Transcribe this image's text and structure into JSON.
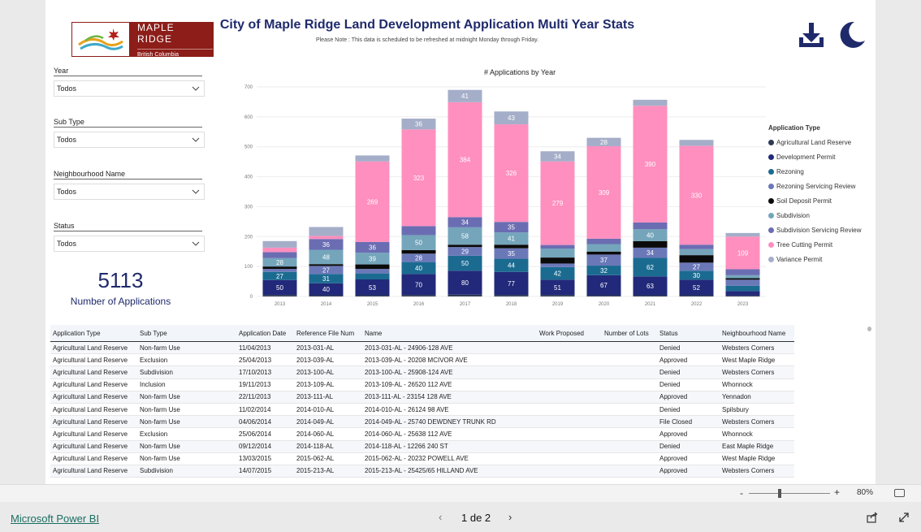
{
  "header": {
    "logo_main": "MAPLE RIDGE",
    "logo_sub": "British Columbia",
    "title": "City of Maple Ridge Land Development Application Multi Year Stats",
    "note": "Please Note : This data is scheduled to be refreshed at midnight Monday through Friday.",
    "download_icon": "download-icon",
    "theme_icon": "moon-icon"
  },
  "filters": [
    {
      "label": "Year",
      "value": "Todos"
    },
    {
      "label": "Sub Type",
      "value": "Todos"
    },
    {
      "label": "Neighbourhood Name",
      "value": "Todos"
    },
    {
      "label": "Status",
      "value": "Todos"
    }
  ],
  "kpi": {
    "value": "5113",
    "label": "Number of Applications"
  },
  "chart_data": {
    "type": "bar",
    "stacked": true,
    "title": "# Applications by Year",
    "categories": [
      "2013",
      "2014",
      "2015",
      "2016",
      "2017",
      "2018",
      "2019",
      "2020",
      "2021",
      "2022",
      "2023"
    ],
    "ylim": [
      0,
      700
    ],
    "yticks": [
      0,
      100,
      200,
      300,
      400,
      500,
      600,
      700
    ],
    "legend_title": "Application Type",
    "legend_position": "right",
    "series": [
      {
        "name": "Agricultural Land Reserve",
        "color": "#2f3b55",
        "values": [
          5,
          4,
          4,
          5,
          6,
          5,
          5,
          4,
          4,
          4,
          3
        ]
      },
      {
        "name": "Development Permit",
        "color": "#22297a",
        "values": [
          50,
          40,
          53,
          70,
          80,
          77,
          51,
          67,
          63,
          52,
          15
        ]
      },
      {
        "name": "Rezoning",
        "color": "#1b6b91",
        "values": [
          27,
          31,
          20,
          40,
          50,
          44,
          42,
          32,
          62,
          30,
          18
        ]
      },
      {
        "name": "Rezoning Servicing Review",
        "color": "#6b78b8",
        "values": [
          10,
          27,
          15,
          28,
          29,
          35,
          12,
          37,
          34,
          27,
          20
        ]
      },
      {
        "name": "Soil Deposit Permit",
        "color": "#0b0b0b",
        "values": [
          8,
          6,
          15,
          12,
          8,
          12,
          20,
          10,
          22,
          25,
          5
        ]
      },
      {
        "name": "Subdivision",
        "color": "#74a5bb",
        "values": [
          28,
          48,
          39,
          50,
          58,
          41,
          30,
          25,
          40,
          20,
          10
        ]
      },
      {
        "name": "Subdivision Servicing Review",
        "color": "#6b6db3",
        "values": [
          20,
          36,
          36,
          30,
          34,
          35,
          12,
          18,
          22,
          15,
          20
        ]
      },
      {
        "name": "Tree Cutting Permit",
        "color": "#ff8fbf",
        "values": [
          15,
          10,
          269,
          323,
          384,
          326,
          279,
          309,
          390,
          330,
          109
        ]
      },
      {
        "name": "Variance Permit",
        "color": "#a5aec8",
        "values": [
          22,
          30,
          20,
          36,
          41,
          43,
          34,
          28,
          20,
          20,
          12
        ]
      }
    ],
    "data_labels": {
      "Development Permit": [
        50,
        40,
        53,
        70,
        80,
        77,
        51,
        67,
        63,
        52,
        null
      ],
      "Rezoning": [
        27,
        31,
        null,
        40,
        50,
        44,
        42,
        32,
        62,
        30,
        null
      ],
      "Rezoning Servicing Review": [
        null,
        27,
        null,
        28,
        29,
        35,
        null,
        37,
        34,
        27,
        null
      ],
      "Subdivision": [
        28,
        48,
        39,
        50,
        58,
        41,
        null,
        null,
        40,
        null,
        null
      ],
      "Subdivision Servicing Review": [
        null,
        36,
        36,
        null,
        34,
        35,
        null,
        null,
        null,
        null,
        null
      ],
      "Tree Cutting Permit": [
        null,
        null,
        269,
        323,
        384,
        326,
        279,
        309,
        390,
        330,
        109
      ],
      "Variance Permit": [
        null,
        null,
        null,
        36,
        41,
        43,
        34,
        28,
        null,
        null,
        null
      ]
    }
  },
  "table": {
    "columns": [
      "Application Type",
      "Sub Type",
      "Application Date",
      "Reference File Num",
      "Name",
      "Work Proposed",
      "Number of Lots",
      "Status",
      "Neighbourhood Name"
    ],
    "rows": [
      [
        "Agricultural Land Reserve",
        "Non-farm Use",
        "11/04/2013",
        "2013-031-AL",
        "2013-031-AL - 24906-128 AVE",
        "",
        "",
        "Denied",
        "Websters Corners"
      ],
      [
        "Agricultural Land Reserve",
        "Exclusion",
        "25/04/2013",
        "2013-039-AL",
        "2013-039-AL - 20208  MCIVOR AVE",
        "",
        "",
        "Approved",
        "West Maple Ridge"
      ],
      [
        "Agricultural Land Reserve",
        "Subdivision",
        "17/10/2013",
        "2013-100-AL",
        "2013-100-AL - 25908-124 AVE",
        "",
        "",
        "Denied",
        "Websters Corners"
      ],
      [
        "Agricultural Land Reserve",
        "Inclusion",
        "19/11/2013",
        "2013-109-AL",
        "2013-109-AL - 26520  112 AVE",
        "",
        "",
        "Denied",
        "Whonnock"
      ],
      [
        "Agricultural Land Reserve",
        "Non-farm Use",
        "22/11/2013",
        "2013-111-AL",
        "2013-111-AL - 23154  128 AVE",
        "",
        "",
        "Approved",
        "Yennadon"
      ],
      [
        "Agricultural Land Reserve",
        "Non-farm Use",
        "11/02/2014",
        "2014-010-AL",
        "2014-010-AL - 26124  98 AVE",
        "",
        "",
        "Denied",
        "Spilsbury"
      ],
      [
        "Agricultural Land Reserve",
        "Non-farm Use",
        "04/06/2014",
        "2014-049-AL",
        "2014-049-AL - 25740  DEWDNEY TRUNK RD",
        "",
        "",
        "File Closed",
        "Websters Corners"
      ],
      [
        "Agricultural Land Reserve",
        "Exclusion",
        "25/06/2014",
        "2014-060-AL",
        "2014-060-AL - 25638  112 AVE",
        "",
        "",
        "Approved",
        "Whonnock"
      ],
      [
        "Agricultural Land Reserve",
        "Non-farm Use",
        "09/12/2014",
        "2014-118-AL",
        "2014-118-AL - 12266  240 ST",
        "",
        "",
        "Denied",
        "East Maple Ridge"
      ],
      [
        "Agricultural Land Reserve",
        "Non-farm Use",
        "13/03/2015",
        "2015-062-AL",
        "2015-062-AL - 20232  POWELL AVE",
        "",
        "",
        "Approved",
        "West Maple Ridge"
      ],
      [
        "Agricultural Land Reserve",
        "Subdivision",
        "14/07/2015",
        "2015-213-AL",
        "2015-213-AL - 25425/65 HILLAND AVE",
        "",
        "",
        "Approved",
        "Websters Corners"
      ]
    ]
  },
  "zoom": {
    "minus": "-",
    "plus": "+",
    "level": "80%"
  },
  "footer": {
    "brand": "Microsoft Power BI",
    "prev": "‹",
    "pages": "1 de 2",
    "next": "›"
  }
}
